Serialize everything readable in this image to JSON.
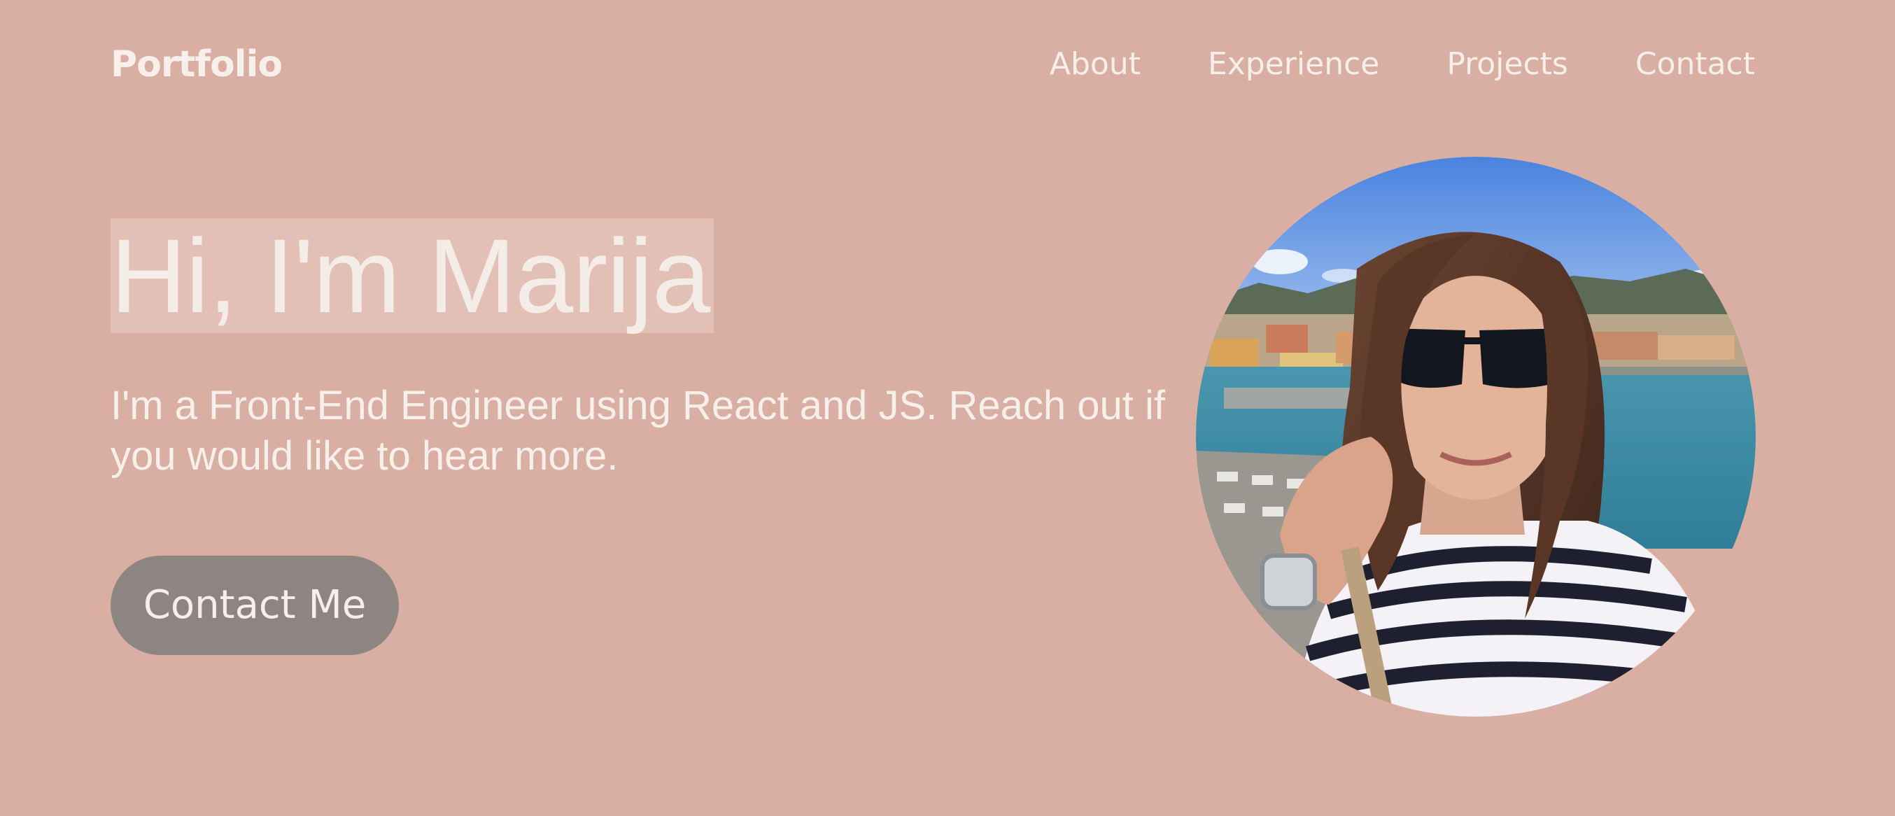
{
  "header": {
    "logo": "Portfolio",
    "nav": [
      "About",
      "Experience",
      "Projects",
      "Contact"
    ]
  },
  "hero": {
    "title": "Hi, I'm Marija",
    "subtitle": "I'm a Front-End Engineer using React and JS. Reach out if you would like to hear more.",
    "cta_label": "Contact Me"
  },
  "avatar": {
    "icon": "profile-photo"
  },
  "colors": {
    "background": "#d9afa3",
    "text": "#f7efe9",
    "button": "#8d8581",
    "title_highlight": "#e8c8bf"
  }
}
